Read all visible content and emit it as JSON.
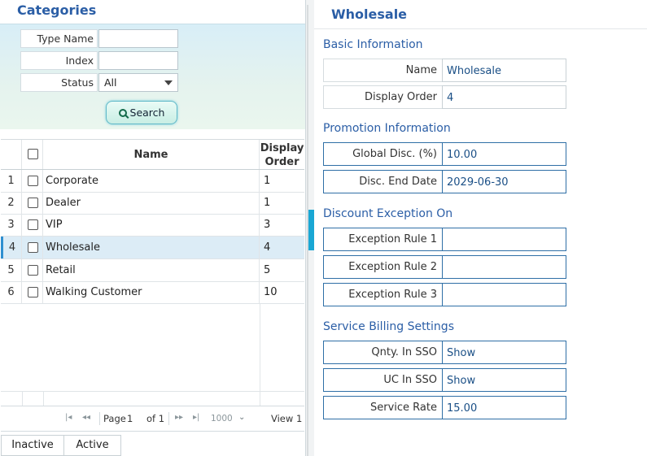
{
  "left_panel": {
    "title": "Categories",
    "filters": {
      "type_name_label": "Type Name",
      "type_name_value": "",
      "index_label": "Index",
      "index_value": "",
      "status_label": "Status",
      "status_value": "All",
      "search_label": "Search"
    },
    "grid": {
      "headers": {
        "name": "Name",
        "display_order_1": "Display",
        "display_order_2": "Order"
      },
      "rows": [
        {
          "num": "1",
          "name": "Corporate",
          "order": "1"
        },
        {
          "num": "2",
          "name": "Dealer",
          "order": "1"
        },
        {
          "num": "3",
          "name": "VIP",
          "order": "3"
        },
        {
          "num": "4",
          "name": "Wholesale",
          "order": "4",
          "selected": true
        },
        {
          "num": "5",
          "name": "Retail",
          "order": "5"
        },
        {
          "num": "6",
          "name": "Walking Customer",
          "order": "10"
        }
      ]
    },
    "pager": {
      "page_label": "Page",
      "page_value": "1",
      "of_label": "of 1",
      "page_size": "1000",
      "view_label": "View 1"
    },
    "tabs": [
      "Inactive",
      "Active"
    ]
  },
  "right_panel": {
    "title": "Wholesale",
    "basic": {
      "heading": "Basic Information",
      "name_label": "Name",
      "name_value": "Wholesale",
      "order_label": "Display Order",
      "order_value": "4"
    },
    "promotion": {
      "heading": "Promotion Information",
      "disc_label": "Global Disc. (%)",
      "disc_value": "10.00",
      "end_label": "Disc. End Date",
      "end_value": "2029-06-30"
    },
    "exception": {
      "heading": "Discount Exception On",
      "rule1_label": "Exception Rule 1",
      "rule1_value": "",
      "rule2_label": "Exception Rule 2",
      "rule2_value": "",
      "rule3_label": "Exception Rule 3",
      "rule3_value": ""
    },
    "billing": {
      "heading": "Service Billing Settings",
      "qnty_label": "Qnty. In SSO",
      "qnty_value": "Show",
      "uc_label": "UC In SSO",
      "uc_value": "Show",
      "rate_label": "Service Rate",
      "rate_value": "15.00"
    }
  },
  "colors": {
    "accent": "#2b5ea6",
    "splitter_handle": "#1aa7d4",
    "selected_row": "#dcecf6"
  },
  "icons": {
    "search": "search-icon",
    "pager_first": "first-page-icon",
    "pager_prev": "prev-page-icon",
    "pager_next": "next-page-icon",
    "pager_last": "last-page-icon"
  }
}
